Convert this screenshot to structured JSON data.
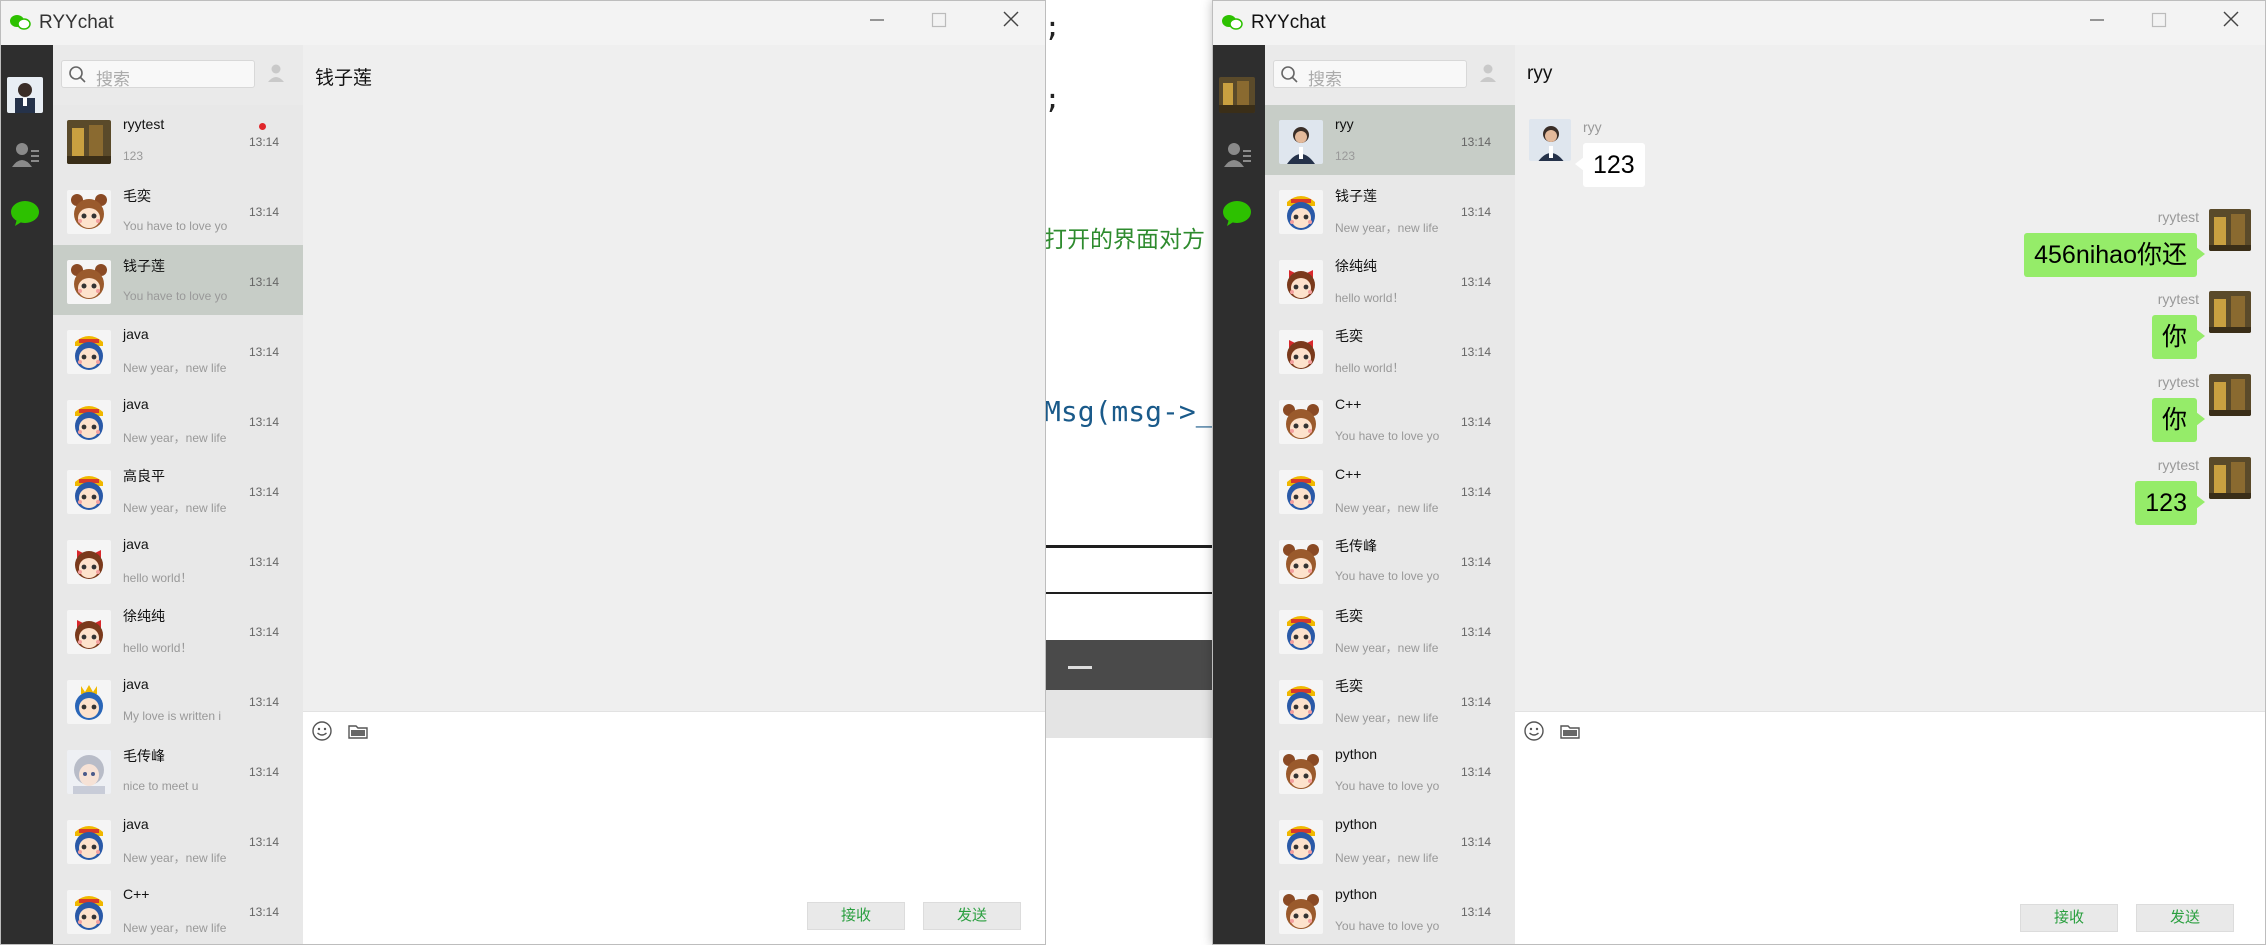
{
  "background_editor": {
    "line1": ";",
    "line2": ";",
    "line3": "打开的界面对方",
    "line4": "Msg(msg->_f"
  },
  "left_window": {
    "title": "RYYchat",
    "search_placeholder": "搜索",
    "active_chat_title": "钱子莲",
    "receive_label": "接收",
    "send_label": "发送",
    "contacts": [
      {
        "name": "ryytest",
        "preview": "123",
        "time": "13:14",
        "avatar": "photo",
        "unread": true
      },
      {
        "name": "毛奕",
        "preview": "You have to love yo",
        "time": "13:14",
        "avatar": "bear"
      },
      {
        "name": "钱子莲",
        "preview": "You have to love yo",
        "time": "13:14",
        "avatar": "bear",
        "selected": true
      },
      {
        "name": "java",
        "preview": "New year，new life",
        "time": "13:14",
        "avatar": "boy"
      },
      {
        "name": "java",
        "preview": "New year，new life",
        "time": "13:14",
        "avatar": "boy"
      },
      {
        "name": "高良平",
        "preview": "New year，new life",
        "time": "13:14",
        "avatar": "boy"
      },
      {
        "name": "java",
        "preview": "hello world！",
        "time": "13:14",
        "avatar": "girl"
      },
      {
        "name": "徐纯纯",
        "preview": "hello world！",
        "time": "13:14",
        "avatar": "girl"
      },
      {
        "name": "java",
        "preview": "My love is written i",
        "time": "13:14",
        "avatar": "prince"
      },
      {
        "name": "毛传峰",
        "preview": "nice to meet u",
        "time": "13:14",
        "avatar": "anime"
      },
      {
        "name": "java",
        "preview": "New year，new life",
        "time": "13:14",
        "avatar": "boy"
      },
      {
        "name": "C++",
        "preview": "New year，new life",
        "time": "13:14",
        "avatar": "boy"
      }
    ]
  },
  "right_window": {
    "title": "RYYchat",
    "search_placeholder": "搜索",
    "active_chat_title": "ryy",
    "receive_label": "接收",
    "send_label": "发送",
    "contacts": [
      {
        "name": "ryy",
        "preview": "123",
        "time": "13:14",
        "avatar": "suit",
        "selected": true
      },
      {
        "name": "钱子莲",
        "preview": "New year，new life",
        "time": "13:14",
        "avatar": "boy"
      },
      {
        "name": "徐纯纯",
        "preview": "hello world！",
        "time": "13:14",
        "avatar": "girl"
      },
      {
        "name": "毛奕",
        "preview": "hello world！",
        "time": "13:14",
        "avatar": "girl"
      },
      {
        "name": "C++",
        "preview": "You have to love yo",
        "time": "13:14",
        "avatar": "bear"
      },
      {
        "name": "C++",
        "preview": "New year，new life",
        "time": "13:14",
        "avatar": "boy"
      },
      {
        "name": "毛传峰",
        "preview": "You have to love yo",
        "time": "13:14",
        "avatar": "bear"
      },
      {
        "name": "毛奕",
        "preview": "New year，new life",
        "time": "13:14",
        "avatar": "boy"
      },
      {
        "name": "毛奕",
        "preview": "New year，new life",
        "time": "13:14",
        "avatar": "boy"
      },
      {
        "name": "python",
        "preview": "You have to love yo",
        "time": "13:14",
        "avatar": "bear"
      },
      {
        "name": "python",
        "preview": "New year，new life",
        "time": "13:14",
        "avatar": "boy"
      },
      {
        "name": "python",
        "preview": "You have to love yo",
        "time": "13:14",
        "avatar": "bear"
      }
    ],
    "messages": [
      {
        "sender": "ryy",
        "text": "123",
        "direction": "in"
      },
      {
        "sender": "ryytest",
        "text": "456nihao你还",
        "direction": "out"
      },
      {
        "sender": "ryytest",
        "text": "你",
        "direction": "out"
      },
      {
        "sender": "ryytest",
        "text": "你",
        "direction": "out"
      },
      {
        "sender": "ryytest",
        "text": "123",
        "direction": "out"
      }
    ]
  },
  "colors": {
    "accent_green": "#2a9f3f",
    "bubble_out": "#95ec69",
    "nav_bg": "#2e2e2e",
    "selected_item": "#c7cdc7",
    "unread_dot": "#e0262b"
  }
}
